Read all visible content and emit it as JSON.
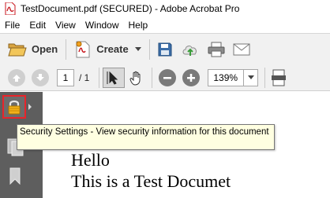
{
  "window": {
    "title": "TestDocument.pdf (SECURED) - Adobe Acrobat Pro"
  },
  "menubar": {
    "items": [
      "File",
      "Edit",
      "View",
      "Window",
      "Help"
    ]
  },
  "toolbar": {
    "open_label": "Open",
    "create_label": "Create"
  },
  "navigation": {
    "page_number": "1",
    "page_total": "/ 1"
  },
  "zoom": {
    "value": "139%"
  },
  "tooltip": {
    "text": "Security Settings - View security information for this document"
  },
  "document": {
    "lines": [
      "Hello",
      "This is a Test Documet"
    ]
  },
  "colors": {
    "accent_red": "#e8242a",
    "panel_gray": "#5e5e5e",
    "tooltip_bg": "#ffffe1",
    "toolbar_bg": "#f1f1f1"
  }
}
